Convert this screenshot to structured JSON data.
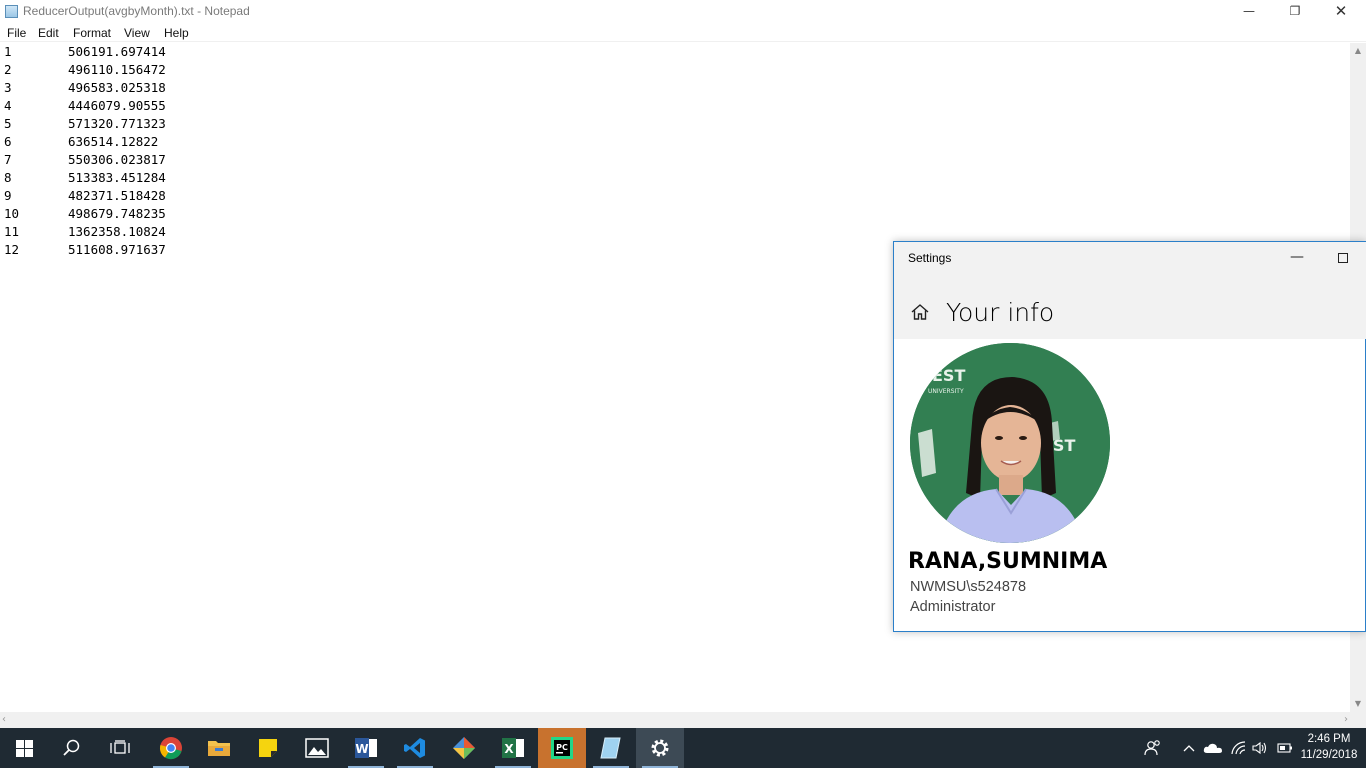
{
  "notepad": {
    "title": "ReducerOutput(avgbyMonth).txt - Notepad",
    "menu": [
      "File",
      "Edit",
      "Format",
      "View",
      "Help"
    ],
    "lines": [
      {
        "key": "1",
        "value": "506191.697414"
      },
      {
        "key": "2",
        "value": "496110.156472"
      },
      {
        "key": "3",
        "value": "496583.025318"
      },
      {
        "key": "4",
        "value": "4446079.90555"
      },
      {
        "key": "5",
        "value": "571320.771323"
      },
      {
        "key": "6",
        "value": "636514.12822"
      },
      {
        "key": "7",
        "value": "550306.023817"
      },
      {
        "key": "8",
        "value": "513383.451284"
      },
      {
        "key": "9",
        "value": "482371.518428"
      },
      {
        "key": "10",
        "value": "498679.748235"
      },
      {
        "key": "11",
        "value": "1362358.10824"
      },
      {
        "key": "12",
        "value": "511608.971637"
      }
    ],
    "controls": {
      "minimize": "—",
      "maximize": "❐",
      "close": "✕"
    }
  },
  "settings": {
    "title": "Settings",
    "heading": "Your info",
    "user_name": "RANA,SUMNIMA",
    "account": "NWMSU\\s524878",
    "role": "Administrator",
    "minimize": "—"
  },
  "taskbar": {
    "clock_time": "2:46 PM",
    "clock_date": "11/29/2018",
    "apps": [
      "start-icon",
      "search-icon",
      "task-view-icon",
      "chrome-icon",
      "file-explorer-icon",
      "sticky-notes-icon",
      "photos-icon",
      "word-icon",
      "vscode-icon",
      "git-icon",
      "excel-icon",
      "pycharm-icon",
      "notepad-icon",
      "settings-icon"
    ]
  },
  "colors": {
    "taskbar": "#1f2a33",
    "settings_border": "#2b7fc9",
    "avatar_bg": "#2f7a4e"
  }
}
